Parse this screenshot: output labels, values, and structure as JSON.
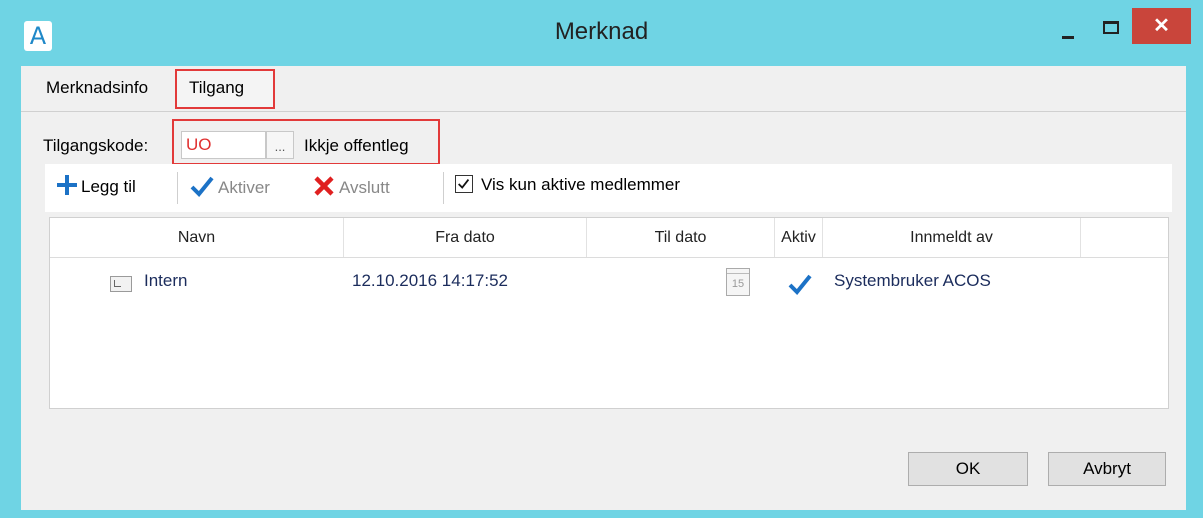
{
  "window": {
    "title": "Merknad",
    "app_icon_letter": "A",
    "close_glyph": "✕"
  },
  "tabs": [
    {
      "label": "Merknadsinfo",
      "selected": false
    },
    {
      "label": "Tilgang",
      "selected": true
    }
  ],
  "access": {
    "label": "Tilgangskode:",
    "code_value": "UO",
    "browse_button": "...",
    "description": "Ikkje offentleg"
  },
  "toolbar": {
    "add_label": "Legg til",
    "activate_label": "Aktiver",
    "end_label": "Avslutt",
    "show_active_label": "Vis kun aktive medlemmer",
    "show_active_checked": true
  },
  "grid": {
    "columns": [
      "Navn",
      "Fra dato",
      "Til dato",
      "Aktiv",
      "Innmeldt av"
    ],
    "rows": [
      {
        "name": "Intern",
        "from_date": "12.10.2016 14:17:52",
        "to_date_icon": "calendar-icon",
        "calendar_day": "15",
        "active": true,
        "registered_by": "Systembruker ACOS"
      }
    ]
  },
  "buttons": {
    "ok": "OK",
    "cancel": "Avbryt"
  },
  "colors": {
    "title_bar": "#6fd4e4",
    "close_button": "#c9453b",
    "highlight_border": "#e23a3a",
    "accent_blue": "#1c72c6",
    "cancel_red": "#e02020"
  }
}
